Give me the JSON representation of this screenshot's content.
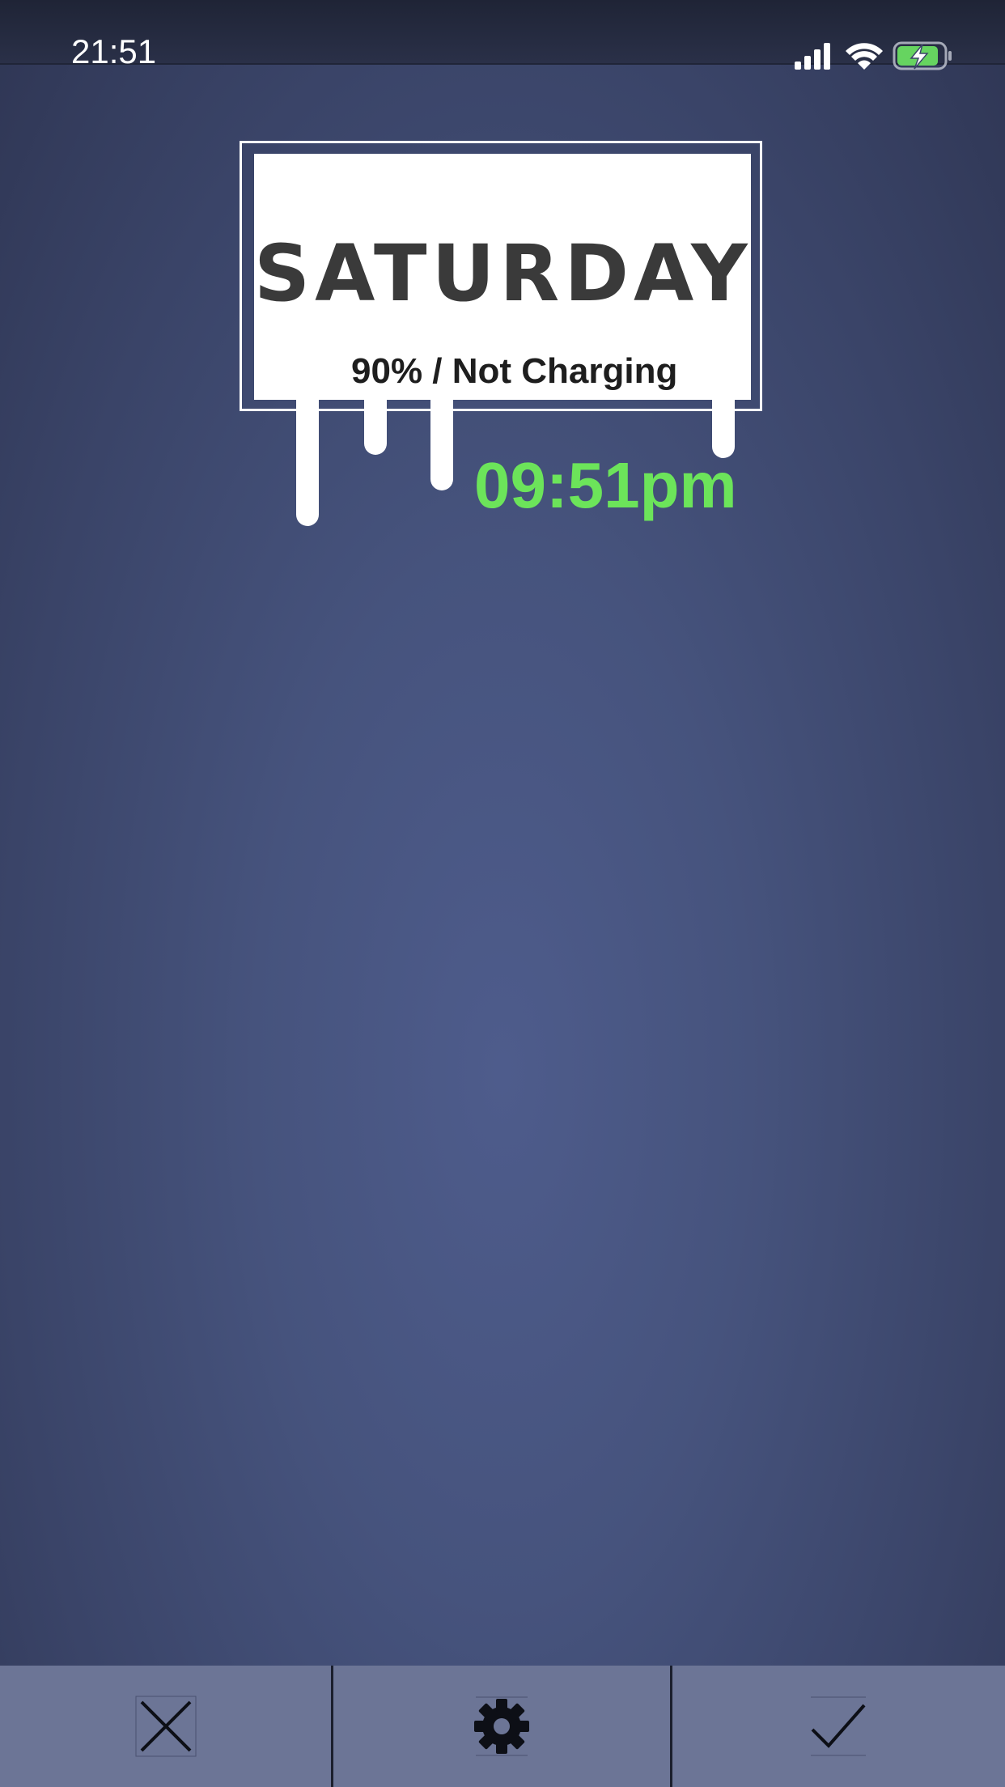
{
  "status_bar": {
    "time": "21:51",
    "icons": [
      "cellular-signal-icon",
      "wifi-icon",
      "battery-charging-icon"
    ],
    "battery_fill_fraction": 0.9,
    "battery_color": "#66d460"
  },
  "widget": {
    "day": "SATURDAY",
    "battery_status": "90% / Not Charging",
    "clock": "09:51pm",
    "clock_color": "#6ce45a"
  },
  "toolbar": {
    "buttons": [
      {
        "icon": "close-icon"
      },
      {
        "icon": "gear-icon"
      },
      {
        "icon": "checkmark-icon"
      }
    ]
  }
}
